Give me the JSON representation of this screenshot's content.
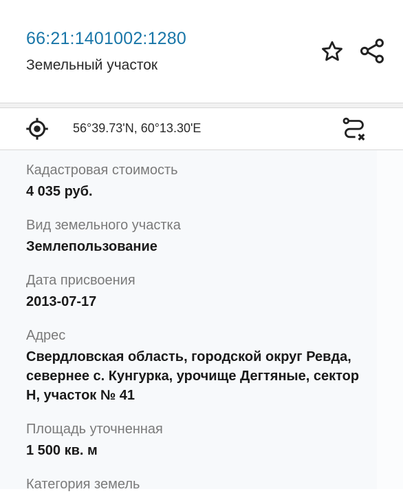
{
  "header": {
    "cadastral_number": "66:21:1401002:1280",
    "object_type": "Земельный участок"
  },
  "icons": {
    "favorite": "star-outline-icon",
    "share": "share-icon",
    "location": "crosshair-location-icon",
    "route": "route-icon"
  },
  "location": {
    "coordinates": "56°39.73'N, 60°13.30'E"
  },
  "fields": [
    {
      "label": "Кадастровая стоимость",
      "value": "4 035 руб."
    },
    {
      "label": "Вид земельного участка",
      "value": "Землепользование"
    },
    {
      "label": "Дата присвоения",
      "value": "2013-07-17"
    },
    {
      "label": "Адрес",
      "value": "Свердловская область, городской округ Ревда, севернее с. Кунгурка, урочище Дегтяные, сектор Н, участок № 41"
    },
    {
      "label": "Площадь уточненная",
      "value": "1 500 кв. м"
    },
    {
      "label": "Категория земель",
      "value": ""
    }
  ],
  "colors": {
    "accent": "#1976a8",
    "text": "#1a1a1a",
    "label": "#7a7a7a",
    "divider": "#d8d8d8"
  }
}
